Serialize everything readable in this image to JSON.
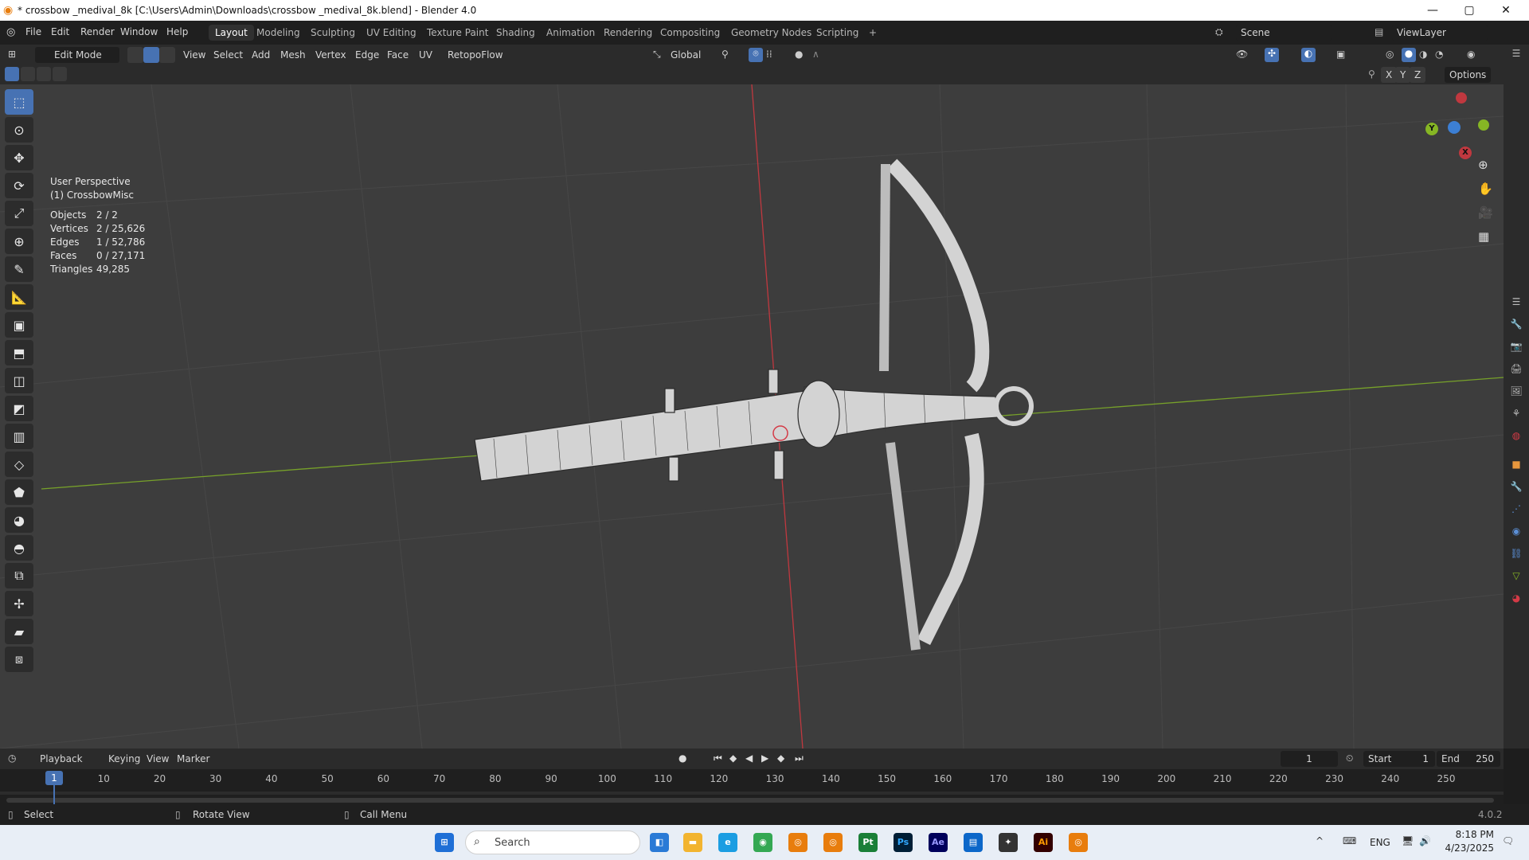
{
  "window": {
    "title": "* crossbow _medival_8k [C:\\Users\\Admin\\Downloads\\crossbow _medival_8k.blend] - Blender 4.0",
    "min": "—",
    "max": "▢",
    "close": "✕"
  },
  "menu": [
    "File",
    "Edit",
    "Render",
    "Window",
    "Help"
  ],
  "workspaces": [
    "Layout",
    "Modeling",
    "Sculpting",
    "UV Editing",
    "Texture Paint",
    "Shading",
    "Animation",
    "Rendering",
    "Compositing",
    "Geometry Nodes",
    "Scripting",
    "+"
  ],
  "active_workspace": "Layout",
  "scene": "Scene",
  "view_layer": "ViewLayer",
  "header": {
    "mode": "Edit Mode",
    "view": "View",
    "select": "Select",
    "add": "Add",
    "mesh": "Mesh",
    "vertex": "Vertex",
    "edge": "Edge",
    "face": "Face",
    "uv": "UV",
    "addon": "RetopoFlow",
    "orientation": "Global",
    "options": "Options",
    "x": "X",
    "y": "Y",
    "z": "Z"
  },
  "viewport": {
    "perspective": "User Perspective",
    "object": "(1) CrossbowMisc"
  },
  "stats": [
    {
      "k": "Objects",
      "v": "2 / 2"
    },
    {
      "k": "Vertices",
      "v": "2 / 25,626"
    },
    {
      "k": "Edges",
      "v": "1 / 52,786"
    },
    {
      "k": "Faces",
      "v": "0 / 27,171"
    },
    {
      "k": "Triangles",
      "v": "49,285"
    }
  ],
  "gizmo": {
    "x": "X",
    "y": "Y",
    "z": "Z"
  },
  "timeline": {
    "playback": "Playback",
    "keying": "Keying",
    "view": "View",
    "marker": "Marker",
    "frame": "1",
    "start_label": "Start",
    "start": "1",
    "end_label": "End",
    "end": "250",
    "ticks": [
      "1",
      "10",
      "20",
      "30",
      "40",
      "50",
      "60",
      "70",
      "80",
      "90",
      "100",
      "110",
      "120",
      "130",
      "140",
      "150",
      "160",
      "170",
      "180",
      "190",
      "200",
      "210",
      "220",
      "230",
      "240",
      "250"
    ]
  },
  "status": {
    "select": "Select",
    "rotate": "Rotate View",
    "call": "Call Menu",
    "version": "4.0.2"
  },
  "taskbar": {
    "search": "Search",
    "lang": "ENG",
    "time": "8:18 PM",
    "date": "4/23/2025"
  },
  "colors": {
    "accent": "#4772b3",
    "x_axis": "#d43a46",
    "y_axis": "#86b624",
    "z_axis": "#3c7fd4"
  }
}
